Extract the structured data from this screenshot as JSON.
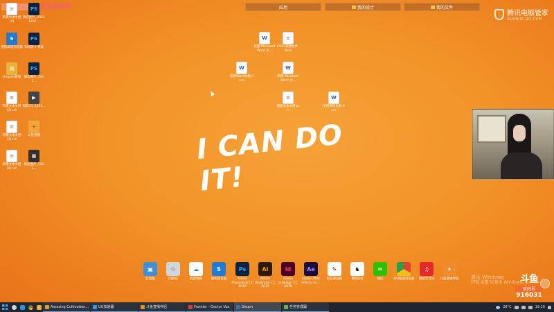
{
  "banner": {
    "text1": "字体在这里",
    "text2": "这里是说明"
  },
  "fences": [
    {
      "label": "应用"
    },
    {
      "label": "我的设计"
    },
    {
      "label": "我的文件"
    }
  ],
  "watermark": {
    "brand": "腾讯电脑管家",
    "domain": "GUANJIA.QQ.COM"
  },
  "slogan": "I CAN DO IT!",
  "desktop_left": [
    {
      "label": "新建文本文档 (4)",
      "icon": "doc"
    },
    {
      "label": "微信图片_20211207...",
      "icon": "ps"
    },
    {
      "label": "搜狗高速浏览器",
      "icon": "sogou"
    },
    {
      "label": "未标题-1-恢复",
      "icon": "ps"
    },
    {
      "label": "Origami教程",
      "icon": "folder"
    },
    {
      "label": "微信图片_2021...",
      "icon": "ps"
    },
    {
      "label": "新建文本文档 (2).txt",
      "icon": "doc"
    },
    {
      "label": "电影(2)_1330...",
      "icon": "video"
    },
    {
      "label": "新建文本文档 (3).txt",
      "icon": "doc"
    },
    {
      "label": "斗鱼直播",
      "icon": "bird"
    },
    {
      "label": "新建文本文档 (4).txt",
      "icon": "doc"
    },
    {
      "label": "微信图片_2021...",
      "icon": "thumb"
    }
  ],
  "desktop_center": [
    {
      "label": "新建 Microsoft Word 文...",
      "icon": "word"
    },
    {
      "label": "CDSS资源文件.docx",
      "icon": "doc"
    },
    {
      "label": "新建Word文档.docx",
      "icon": "word"
    },
    {
      "label": "新建 Microsoft Word 文...",
      "icon": "word"
    },
    {
      "label": "新建文本文档.txt",
      "icon": "doc"
    },
    {
      "label": "文档资料大纲.docx",
      "icon": "word"
    }
  ],
  "dock": [
    {
      "label": "此电脑",
      "icon": "pc",
      "glyph": "▣"
    },
    {
      "label": "回收站",
      "icon": "bin",
      "glyph": "♲"
    },
    {
      "label": "百度网盘",
      "icon": "baidu",
      "glyph": "☁"
    },
    {
      "label": "搜狗浏览器",
      "icon": "sogou",
      "glyph": "S"
    },
    {
      "label": "Adobe Photoshop CC 2019",
      "icon": "ps",
      "glyph": "Ps"
    },
    {
      "label": "Adobe Illustrator CC 2019",
      "icon": "ai",
      "glyph": "Ai"
    },
    {
      "label": "Adobe InDesign CC 2019",
      "icon": "id",
      "glyph": "Id"
    },
    {
      "label": "Adobe After Effects CC...",
      "icon": "ae",
      "glyph": "Ae"
    },
    {
      "label": "好友阅读器",
      "icon": "note",
      "glyph": "✎"
    },
    {
      "label": "腾讯QQ",
      "icon": "qq",
      "glyph": "♞"
    },
    {
      "label": "微信",
      "icon": "wechat",
      "glyph": "✉"
    },
    {
      "label": "360极速浏览器",
      "icon": "chrome",
      "glyph": ""
    },
    {
      "label": "网易云音乐",
      "icon": "netease",
      "glyph": "♫"
    },
    {
      "label": "斗鱼直播伴侣",
      "icon": "douyu",
      "glyph": "✦"
    }
  ],
  "windows_activation": {
    "line1": "激活 Windows",
    "line2": "转到'设置'以激活 Windows。"
  },
  "douyu": {
    "logo": "斗鱼",
    "room_label": "房间号",
    "room_number": "916031"
  },
  "taskbar": {
    "tasks": [
      {
        "label": "Amazing Cultivation...",
        "color": "#e0a030"
      },
      {
        "label": "UU加速器",
        "color": "#3f8fe0"
      },
      {
        "label": "斗鱼直播伴侣",
        "color": "#f08a2c"
      },
      {
        "label": "Frontier - Doctor Vox",
        "color": "#d04040"
      },
      {
        "label": "Steam",
        "color": "#3a6ea5",
        "active": true
      },
      {
        "label": "任务管理器",
        "color": "#6ab04c"
      }
    ],
    "tray": {
      "temp": "28°C",
      "time": "19:16"
    }
  }
}
